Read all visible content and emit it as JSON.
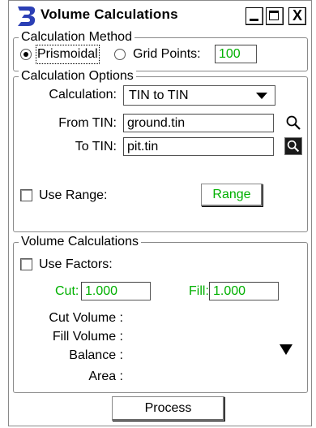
{
  "window": {
    "title": "Volume Calculations",
    "close_glyph": "X"
  },
  "calculation_method": {
    "legend": "Calculation Method",
    "options": [
      {
        "label": "Prismoidal",
        "selected": true
      },
      {
        "label": "Grid Points:",
        "selected": false
      }
    ],
    "grid_points_value": "100"
  },
  "calculation_options": {
    "legend": "Calculation Options",
    "calculation_label": "Calculation:",
    "calculation_value": "TIN to TIN",
    "from_tin_label": "From TIN:",
    "from_tin_value": "ground.tin",
    "to_tin_label": "To TIN:",
    "to_tin_value": "pit.tin",
    "use_range_label": "Use Range:",
    "use_range_checked": false,
    "range_button": "Range"
  },
  "volume_calculations": {
    "legend": "Volume Calculations",
    "use_factors_label": "Use Factors:",
    "use_factors_checked": false,
    "cut_label": "Cut:",
    "cut_value": "1.000",
    "fill_label": "Fill:",
    "fill_value": "1.000",
    "results": {
      "cut_volume": "Cut Volume :",
      "fill_volume": "Fill Volume :",
      "balance": "Balance :",
      "area": "Area :"
    }
  },
  "process_button": "Process",
  "icons": {
    "app": "microstation-b-logo-icon",
    "browse_from": "magnifier-icon",
    "browse_to": "magnifier-icon"
  },
  "colors": {
    "accent_green": "#00b000",
    "logo_blue": "#2b3fb5"
  }
}
